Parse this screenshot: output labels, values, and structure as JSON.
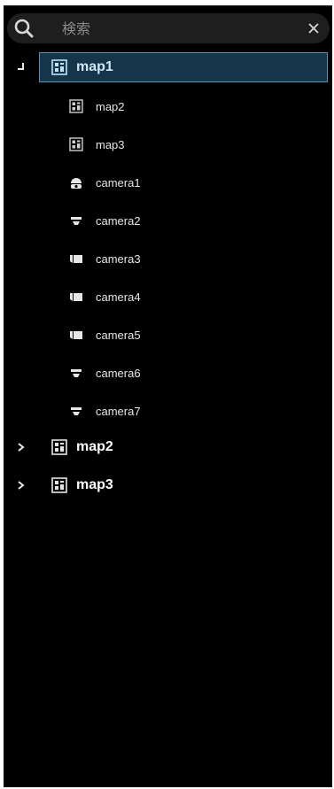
{
  "search": {
    "placeholder": "検索",
    "value": ""
  },
  "tree": {
    "root": {
      "label": "map1",
      "expanded": true,
      "selected": true,
      "icon": "map-icon",
      "children": [
        {
          "label": "map2",
          "icon": "map-icon"
        },
        {
          "label": "map3",
          "icon": "map-icon"
        },
        {
          "label": "camera1",
          "icon": "dome-camera-icon"
        },
        {
          "label": "camera2",
          "icon": "ceiling-camera-icon"
        },
        {
          "label": "camera3",
          "icon": "box-camera-icon"
        },
        {
          "label": "camera4",
          "icon": "box-camera-icon"
        },
        {
          "label": "camera5",
          "icon": "box-camera-icon"
        },
        {
          "label": "camera6",
          "icon": "ceiling-camera-icon"
        },
        {
          "label": "camera7",
          "icon": "ceiling-camera-icon"
        }
      ]
    },
    "siblings": [
      {
        "label": "map2",
        "expanded": false,
        "icon": "map-icon"
      },
      {
        "label": "map3",
        "expanded": false,
        "icon": "map-icon"
      }
    ]
  },
  "colors": {
    "background": "#000000",
    "selection_fill": "#143648",
    "selection_border": "#5c8fb0",
    "search_bg": "#1e1e1e"
  }
}
